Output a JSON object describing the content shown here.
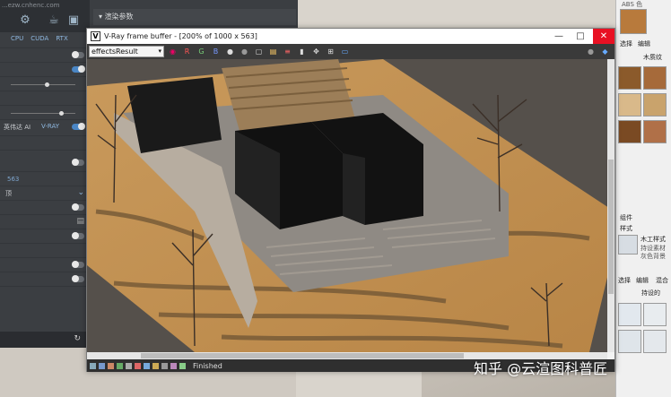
{
  "left_panel": {
    "url_text": "...ezw.cnhenc.com",
    "render_tabs": [
      "CPU",
      "CUDA",
      "RTX"
    ],
    "engine_left": "英伟达 AI",
    "engine_right": "V-RAY",
    "value_563": "563",
    "dropdown_label": "顶"
  },
  "render_dialog": {
    "title": "渲染参数"
  },
  "vfb": {
    "title": "V-Ray frame buffer - [200% of 1000 x 563]",
    "channel": "effectsResult",
    "channels": [
      "R",
      "G",
      "B"
    ],
    "status": "Finished",
    "minimize": "—",
    "maximize": "□",
    "close": "✕"
  },
  "right_panel": {
    "material_name": "ABS 色",
    "tab_edit": "编辑",
    "tab_select": "选择",
    "material_tag": "木质纹",
    "section_component": "组件",
    "section_style": "样式",
    "style_name": "木工样式",
    "style_desc1": "持设素材",
    "style_desc2": "灰色背景",
    "tab_select2": "选择",
    "tab_edit2": "编辑",
    "tab_mix": "混合",
    "default_tag": "持设的"
  },
  "watermark": "知乎 @云渲图科普匠",
  "colors": {
    "accent": "#4a86c5",
    "close": "#e81123",
    "panel": "#3b3e42"
  }
}
